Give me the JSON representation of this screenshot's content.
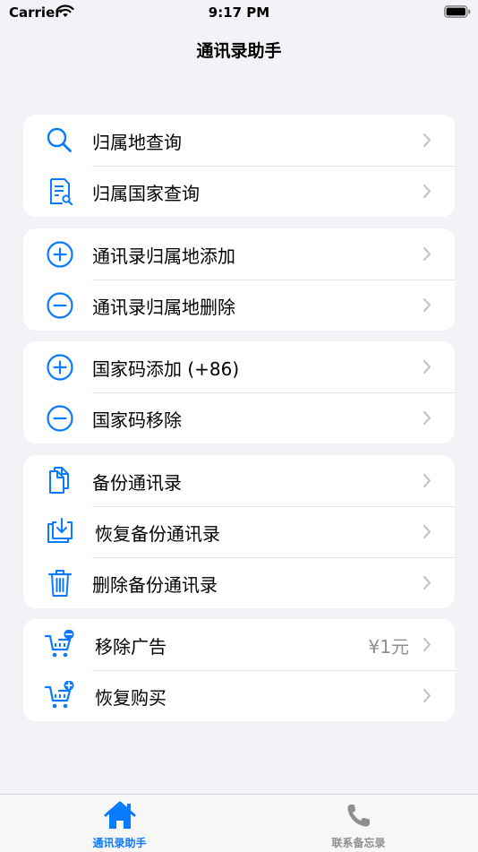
{
  "status": {
    "carrier": "Carrier",
    "time": "9:17 PM"
  },
  "nav": {
    "title": "通讯录助手"
  },
  "groups": [
    {
      "items": [
        {
          "label": "归属地查询",
          "icon": "search-icon"
        },
        {
          "label": "归属国家查询",
          "icon": "document-search-icon"
        }
      ]
    },
    {
      "items": [
        {
          "label": "通讯录归属地添加",
          "icon": "plus-circle-icon"
        },
        {
          "label": "通讯录归属地删除",
          "icon": "minus-circle-icon"
        }
      ]
    },
    {
      "items": [
        {
          "label": "国家码添加 (+86)",
          "icon": "plus-circle-icon"
        },
        {
          "label": "国家码移除",
          "icon": "minus-circle-icon"
        }
      ]
    },
    {
      "items": [
        {
          "label": "备份通讯录",
          "icon": "documents-icon"
        },
        {
          "label": "恢复备份通讯录",
          "icon": "restore-download-icon"
        },
        {
          "label": "删除备份通讯录",
          "icon": "trash-icon"
        }
      ]
    },
    {
      "items": [
        {
          "label": "移除广告",
          "value": "¥1元",
          "icon": "cart-minus-icon"
        },
        {
          "label": "恢复购买",
          "icon": "cart-plus-icon"
        }
      ]
    }
  ],
  "tabs": [
    {
      "label": "通讯录助手",
      "icon": "house-icon",
      "selected": true
    },
    {
      "label": "联系备忘录",
      "icon": "phone-icon",
      "selected": false
    }
  ],
  "colors": {
    "accent": "#0A7AFF",
    "background": "#F2F2F7",
    "chevron": "#C4C4C7",
    "inactive_tab": "#8E8E93"
  }
}
